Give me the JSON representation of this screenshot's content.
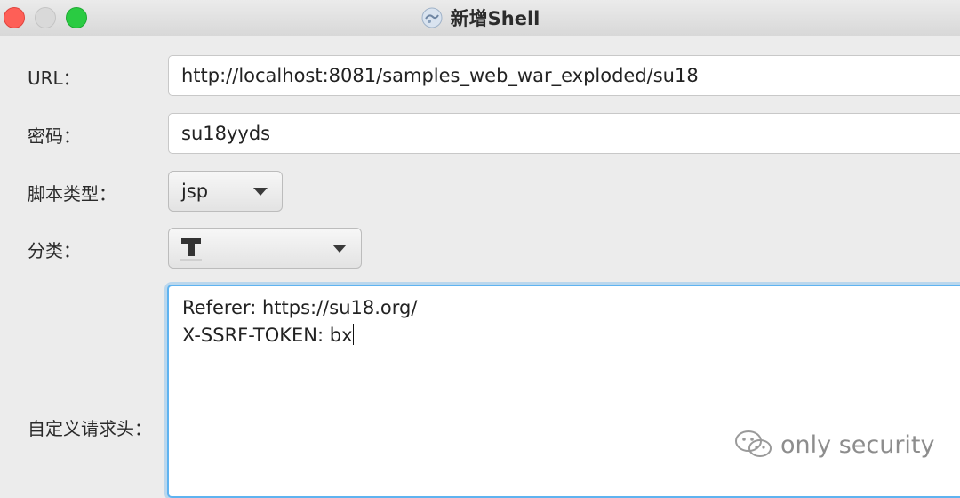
{
  "window": {
    "title": "新增Shell",
    "app_icon": "shell-app-icon"
  },
  "form": {
    "url_label": "URL：",
    "url_value": "http://localhost:8081/samples_web_war_exploded/su18",
    "password_label": "密码：",
    "password_value": "su18yyds",
    "script_type_label": "脚本类型：",
    "script_type_value": "jsp",
    "category_label": "分类：",
    "category_icon": "folder-category-icon",
    "headers_label": "自定义请求头：",
    "headers_lines": [
      "Referer: https://su18.org/",
      "X-SSRF-TOKEN: bx"
    ]
  },
  "watermark": {
    "text": "only security",
    "icon": "wechat-icon"
  },
  "colors": {
    "focus_border": "#5fb3f0",
    "close": "#fe5f57",
    "minimize": "#d9d9d9",
    "maximize": "#2acb42"
  }
}
